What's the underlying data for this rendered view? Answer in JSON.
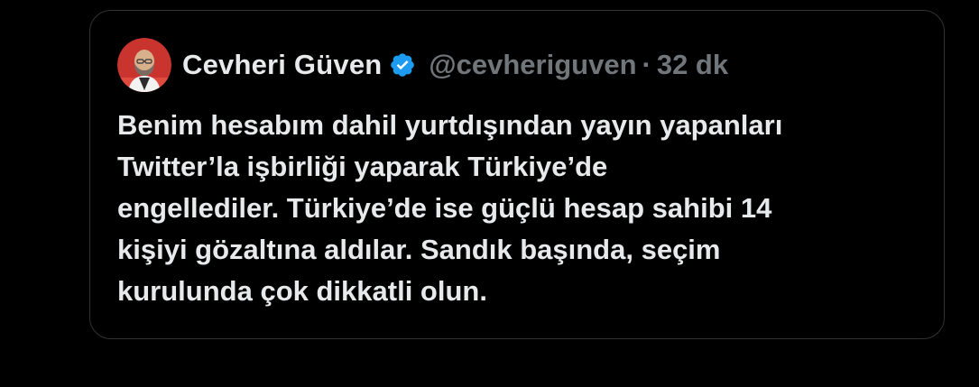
{
  "tweet": {
    "author": {
      "display_name": "Cevheri Güven",
      "handle": "@cevheriguven",
      "verified_icon": "verified-badge-icon",
      "avatar_icon": "avatar"
    },
    "separator": "·",
    "time": "32 dk",
    "text": "Benim hesabım dahil yurtdışından yayın yapanları\nTwitter’la işbirliği yaparak Türkiye’de\nengellediler. Türkiye’de ise güçlü hesap sahibi 14\nkişiyi gözaltına aldılar. Sandık başında, seçim\nkurulunda çok dikkatli olun."
  },
  "colors": {
    "background": "#000000",
    "text": "#e7e9ea",
    "muted": "#71767b",
    "border": "#2f3336",
    "verified": "#1d9bf0",
    "avatar_bg": "#c9342f"
  }
}
